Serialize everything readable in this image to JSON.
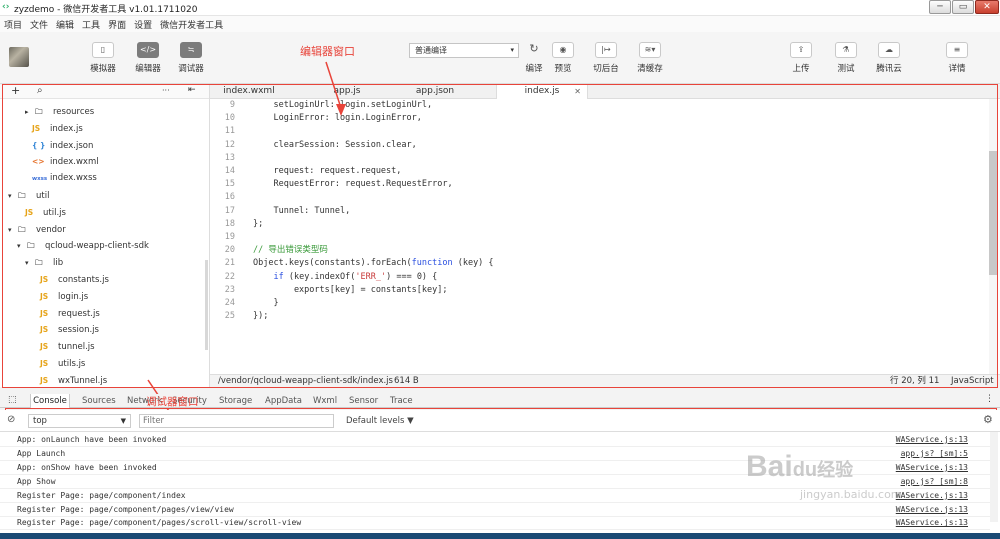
{
  "window": {
    "title": "zyzdemo - 微信开发者工具 v1.01.1711020",
    "minimize": "─",
    "maximize": "▭",
    "close": "✕"
  },
  "menu": [
    "项目",
    "文件",
    "编辑",
    "工具",
    "界面",
    "设置",
    "微信开发者工具"
  ],
  "toolbar": {
    "left_buttons": [
      {
        "label": "模拟器",
        "icon": "phone-icon",
        "glyph": "▯",
        "active": false
      },
      {
        "label": "编辑器",
        "icon": "code-icon",
        "glyph": "</>",
        "active": true
      },
      {
        "label": "调试器",
        "icon": "debugger-icon",
        "glyph": "≒",
        "active": true
      }
    ],
    "compile_mode": "普通编译",
    "mid_buttons": [
      {
        "label": "编译",
        "icon": "refresh-icon",
        "glyph": "↻"
      },
      {
        "label": "预览",
        "icon": "eye-icon",
        "glyph": "◉"
      },
      {
        "label": "切后台",
        "icon": "background-icon",
        "glyph": "|↦"
      },
      {
        "label": "清缓存",
        "icon": "layers-icon",
        "glyph": "≋▾"
      }
    ],
    "right_buttons": [
      {
        "label": "上传",
        "icon": "upload-icon",
        "glyph": "⇪"
      },
      {
        "label": "测试",
        "icon": "flask-icon",
        "glyph": "⚗"
      },
      {
        "label": "腾讯云",
        "icon": "cloud-icon",
        "glyph": "☁"
      },
      {
        "label": "详情",
        "icon": "menu-icon",
        "glyph": "≡"
      }
    ]
  },
  "annotations": {
    "editor": "编辑器窗口",
    "debugger": "调试器窗口"
  },
  "sidebar": {
    "add": "+",
    "search": "⌕",
    "more": "···",
    "collapse": "⇤",
    "items": [
      {
        "label": "resources",
        "type": "folder",
        "arrow": "▸",
        "indent": 2
      },
      {
        "label": "index.js",
        "type": "js",
        "indent": 3
      },
      {
        "label": "index.json",
        "type": "json",
        "indent": 3
      },
      {
        "label": "index.wxml",
        "type": "wxml",
        "indent": 3
      },
      {
        "label": "index.wxss",
        "type": "wxss",
        "indent": 3
      },
      {
        "label": "util",
        "type": "folder",
        "arrow": "▾",
        "indent": 0
      },
      {
        "label": "util.js",
        "type": "js",
        "indent": 2
      },
      {
        "label": "vendor",
        "type": "folder",
        "arrow": "▾",
        "indent": 0
      },
      {
        "label": "qcloud-weapp-client-sdk",
        "type": "folder",
        "arrow": "▾",
        "indent": 1
      },
      {
        "label": "lib",
        "type": "folder",
        "arrow": "▾",
        "indent": 2
      },
      {
        "label": "constants.js",
        "type": "js",
        "indent": 4
      },
      {
        "label": "login.js",
        "type": "js",
        "indent": 4
      },
      {
        "label": "request.js",
        "type": "js",
        "indent": 4
      },
      {
        "label": "session.js",
        "type": "js",
        "indent": 4
      },
      {
        "label": "tunnel.js",
        "type": "js",
        "indent": 4
      },
      {
        "label": "utils.js",
        "type": "js",
        "indent": 4
      },
      {
        "label": "wxTunnel.js",
        "type": "js",
        "indent": 4
      }
    ]
  },
  "editor_tabs": [
    {
      "label": "index.wxml",
      "active": false
    },
    {
      "label": "app.js",
      "active": false
    },
    {
      "label": "app.json",
      "active": false
    },
    {
      "label": "index.js",
      "active": true,
      "close": "✕"
    }
  ],
  "code": [
    {
      "n": "9",
      "html": "    setLoginUrl: login.setLoginUrl,"
    },
    {
      "n": "10",
      "html": "    LoginError: login.LoginError,"
    },
    {
      "n": "11",
      "html": ""
    },
    {
      "n": "12",
      "html": "    clearSession: Session.clear,"
    },
    {
      "n": "13",
      "html": ""
    },
    {
      "n": "14",
      "html": "    request: request.request,"
    },
    {
      "n": "15",
      "html": "    RequestError: request.RequestError,"
    },
    {
      "n": "16",
      "html": ""
    },
    {
      "n": "17",
      "html": "    Tunnel: Tunnel,"
    },
    {
      "n": "18",
      "html": "};"
    },
    {
      "n": "19",
      "html": ""
    },
    {
      "n": "20",
      "html": "<span class='cm'>// 导出错误类型码</span>"
    },
    {
      "n": "21",
      "html": "Object.keys(constants).forEach(<span class='kw'>function</span> (key) {"
    },
    {
      "n": "22",
      "html": "    <span class='kw'>if</span> (key.indexOf(<span class='str'>'ERR_'</span>) === 0) {"
    },
    {
      "n": "23",
      "html": "        exports[key] = constants[key];"
    },
    {
      "n": "24",
      "html": "    }"
    },
    {
      "n": "25",
      "html": "});"
    }
  ],
  "status": {
    "path": "/vendor/qcloud-weapp-client-sdk/index.js",
    "size": "614 B",
    "position": "行 20, 列 11",
    "language": "JavaScript"
  },
  "devtools": {
    "tabs": [
      "Console",
      "Sources",
      "Network",
      "Security",
      "Storage",
      "AppData",
      "Wxml",
      "Sensor",
      "Trace"
    ],
    "context": "top",
    "filter_placeholder": "Filter",
    "levels": "Default levels ▼",
    "logs": [
      {
        "msg": "App: onLaunch have been invoked",
        "src": "WAService.js:13"
      },
      {
        "msg": "App Launch",
        "src": "app.js? [sm]:5"
      },
      {
        "msg": "App: onShow have been invoked",
        "src": "WAService.js:13"
      },
      {
        "msg": "App Show",
        "src": "app.js? [sm]:8"
      },
      {
        "msg": "Register Page: page/component/index",
        "src": "WAService.js:13"
      },
      {
        "msg": "Register Page: page/component/pages/view/view",
        "src": "WAService.js:13"
      },
      {
        "msg": "Register Page: page/component/pages/scroll-view/scroll-view",
        "src": "WAService.js:13"
      }
    ]
  },
  "watermark": {
    "brand": "Bai",
    "paw": "du",
    "suffix": "经验",
    "url": "jingyan.baidu.com"
  }
}
